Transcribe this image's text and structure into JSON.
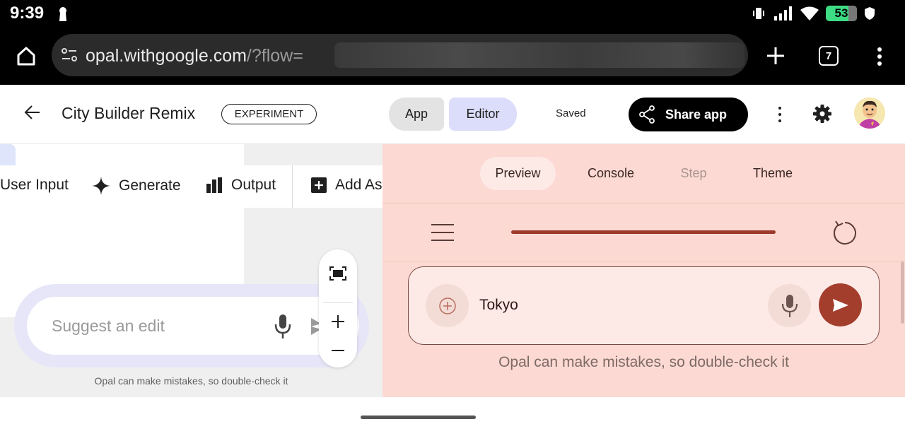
{
  "status_bar": {
    "time": "9:39",
    "battery": "53"
  },
  "browser": {
    "url_main": "opal.withgoogle.com",
    "url_query": "/?flow=",
    "tab_count": "7"
  },
  "header": {
    "title": "City Builder Remix",
    "badge": "EXPERIMENT",
    "tab_app": "App",
    "tab_editor": "Editor",
    "save_status": "Saved",
    "share_label": "Share app"
  },
  "canvas": {
    "toolbar": {
      "user_input": "User Input",
      "generate": "Generate",
      "output": "Output",
      "add_asset": "Add As"
    },
    "suggest_placeholder": "Suggest an edit",
    "disclaimer": "Opal can make mistakes, so double-check it"
  },
  "preview": {
    "tabs": [
      "Preview",
      "Console",
      "Step",
      "Theme"
    ],
    "progress": 1.0,
    "input_value": "Tokyo",
    "disclaimer": "Opal can make mistakes, so double-check it"
  },
  "colors": {
    "accent_editor": "#dcdcfb",
    "preview_bg": "#fdd9d3",
    "send_button": "#a43e2c",
    "battery": "#3ddc84"
  }
}
